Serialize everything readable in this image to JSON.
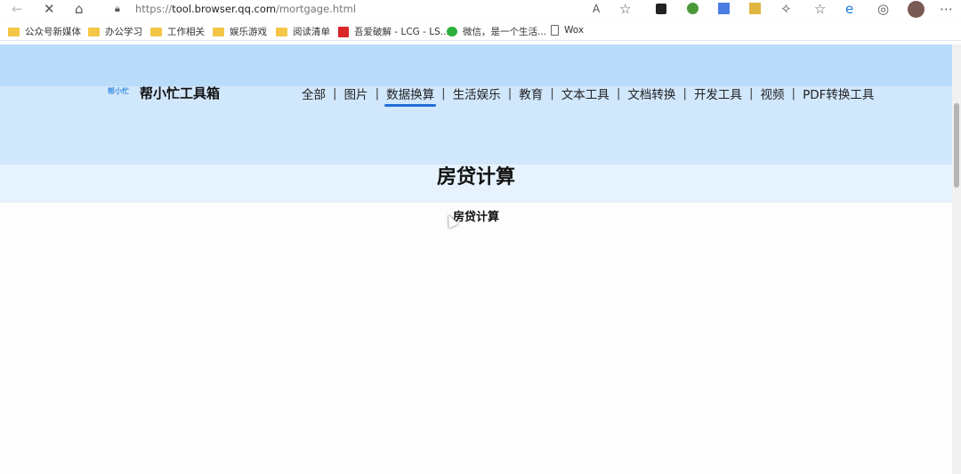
{
  "browser": {
    "url_prefix": "https://",
    "url_domain": "tool.browser.qq.com",
    "url_path": "/mortgage.html",
    "bookmarks": [
      "公众号新媒体",
      "办公学习",
      "工作相关",
      "娱乐游戏",
      "阅读清单",
      "吾爱破解 - LCG - LS...",
      "微信，是一个生活...",
      "Wox"
    ]
  },
  "site": {
    "logo_text": "帮小忙",
    "brand": "帮小忙工具箱",
    "nav": [
      "全部",
      "图片",
      "数据换算",
      "生活娱乐",
      "教育",
      "文本工具",
      "文档转换",
      "开发工具",
      "视频",
      "PDF转换工具"
    ],
    "active_nav": "数据换算"
  },
  "page": {
    "title": "房贷计算",
    "subtitle": "房贷计算"
  }
}
